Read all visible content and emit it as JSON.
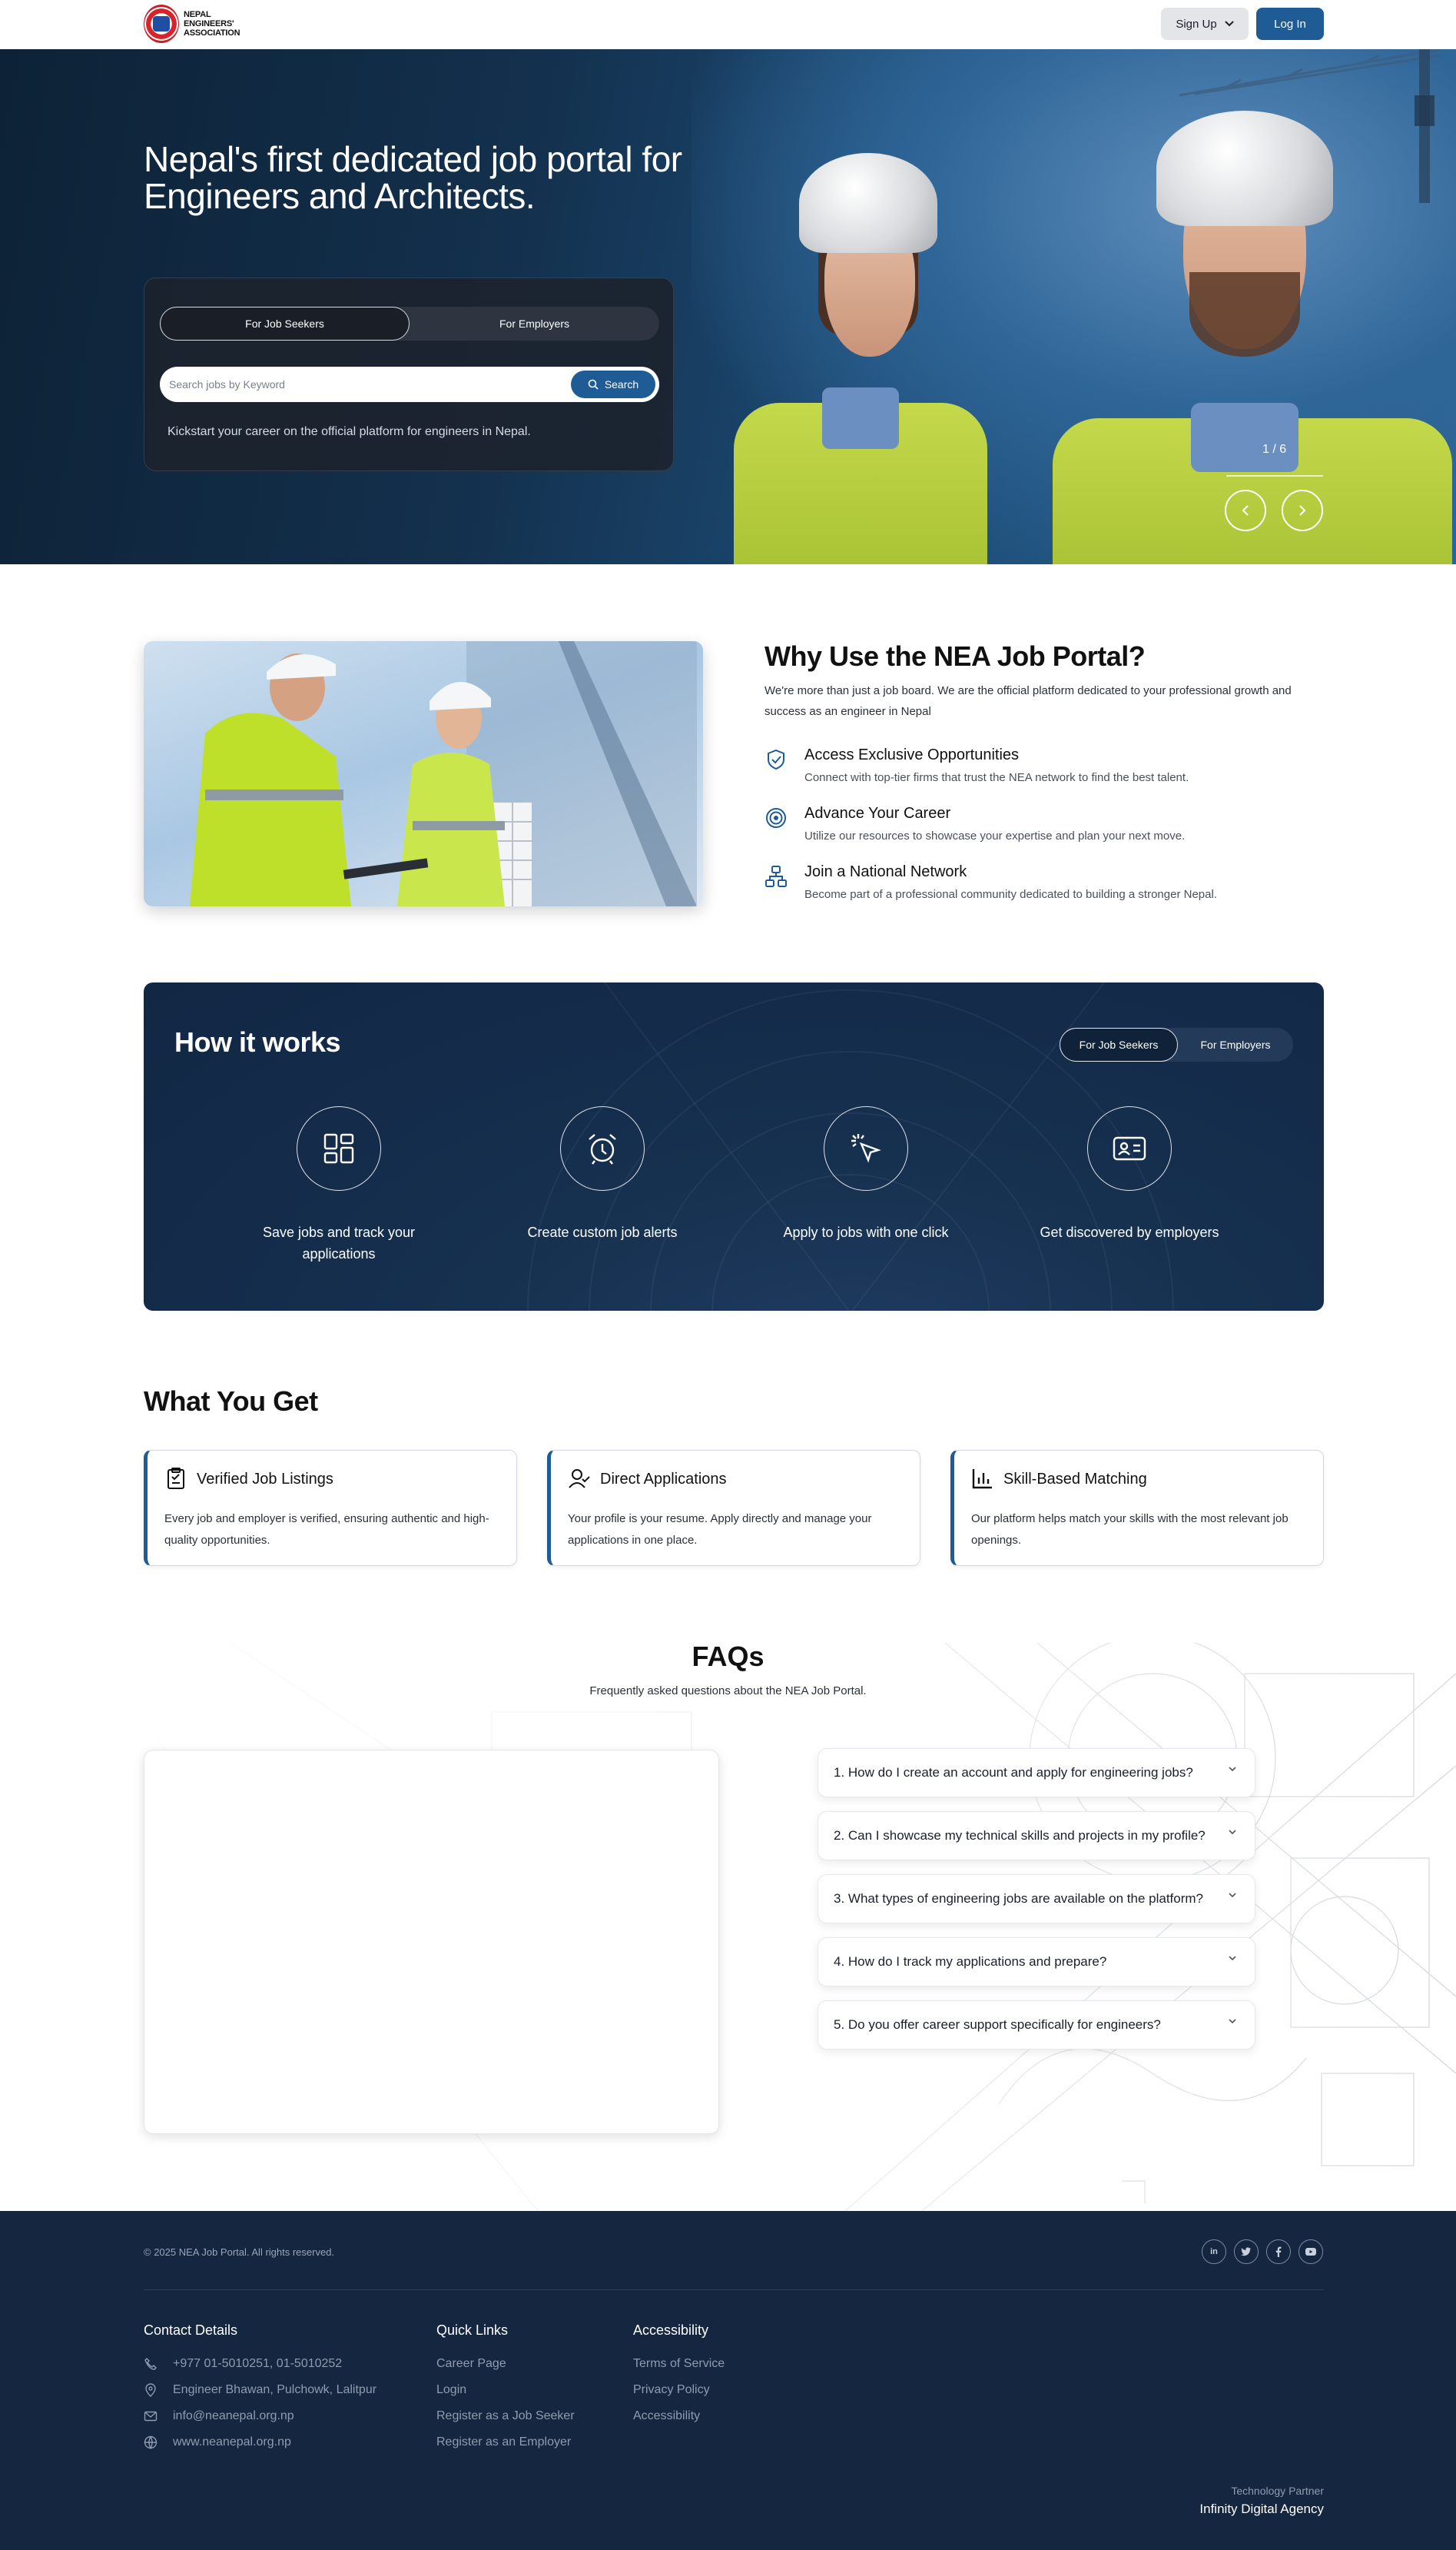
{
  "header": {
    "logo_text": "NEPAL ENGINEERS' ASSOCIATION",
    "signup_label": "Sign Up",
    "login_label": "Log In"
  },
  "hero": {
    "title": "Nepal's first dedicated job portal for Engineers and Architects.",
    "tabs": [
      "For Job Seekers",
      "For Employers"
    ],
    "search_placeholder": "Search jobs by Keyword",
    "search_button": "Search",
    "subtitle": "Kickstart your career on the official platform for engineers in Nepal.",
    "slide_counter": "1 / 6"
  },
  "why": {
    "title": "Why Use the NEA Job Portal?",
    "intro": "We're more than just a job board. We are the official platform dedicated to your professional growth and success as an engineer in Nepal",
    "features": [
      {
        "title": "Access Exclusive Opportunities",
        "desc": "Connect with top-tier firms that trust the NEA network to find the best talent.",
        "icon": "shield-check-icon"
      },
      {
        "title": "Advance Your Career",
        "desc": "Utilize our resources to showcase your expertise and plan your next move.",
        "icon": "target-icon"
      },
      {
        "title": "Join a National Network",
        "desc": "Become part of a professional community dedicated to building a stronger Nepal.",
        "icon": "network-icon"
      }
    ]
  },
  "how": {
    "title": "How it works",
    "tabs": [
      "For Job Seekers",
      "For Employers"
    ],
    "steps": [
      {
        "label": "Save jobs and track your applications",
        "icon": "dashboard-grid-icon"
      },
      {
        "label": "Create custom job alerts",
        "icon": "alarm-clock-icon"
      },
      {
        "label": "Apply to jobs with one click",
        "icon": "cursor-click-icon"
      },
      {
        "label": "Get discovered by employers",
        "icon": "id-card-icon"
      }
    ]
  },
  "what_you_get": {
    "title": "What You Get",
    "cards": [
      {
        "title": "Verified Job Listings",
        "desc": "Every job and employer is verified, ensuring authentic and high-quality opportunities.",
        "icon": "clipboard-check-icon"
      },
      {
        "title": "Direct Applications",
        "desc": "Your profile is your resume. Apply directly and manage your applications in one place.",
        "icon": "user-check-icon"
      },
      {
        "title": "Skill-Based Matching",
        "desc": "Our platform helps match your skills with the most relevant job openings.",
        "icon": "bar-chart-icon"
      }
    ]
  },
  "faq": {
    "title": "FAQs",
    "subtitle": "Frequently asked questions about the NEA Job Portal.",
    "items": [
      "1. How do I create an account and apply for engineering jobs?",
      "2. Can I showcase my technical skills and projects in my profile?",
      "3. What types of engineering jobs are available on the platform?",
      "4. How do I track my applications and prepare?",
      "5. Do you offer career support specifically for engineers?"
    ]
  },
  "footer": {
    "copyright": "© 2025 NEA Job Portal. All rights reserved.",
    "social": [
      "in",
      "t",
      "f",
      "yt"
    ],
    "contact": {
      "heading": "Contact Details",
      "phone": "+977 01-5010251, 01-5010252",
      "address": "Engineer Bhawan, Pulchowk, Lalitpur",
      "email": "info@neanepal.org.np",
      "website": "www.neanepal.org.np"
    },
    "quick_links": {
      "heading": "Quick Links",
      "items": [
        "Career Page",
        "Login",
        "Register as a Job Seeker",
        "Register as an Employer"
      ]
    },
    "accessibility": {
      "heading": "Accessibility",
      "items": [
        "Terms of Service",
        "Privacy Policy",
        "Accessibility"
      ]
    },
    "partner_label": "Technology Partner",
    "partner_name": "Infinity Digital Agency"
  }
}
